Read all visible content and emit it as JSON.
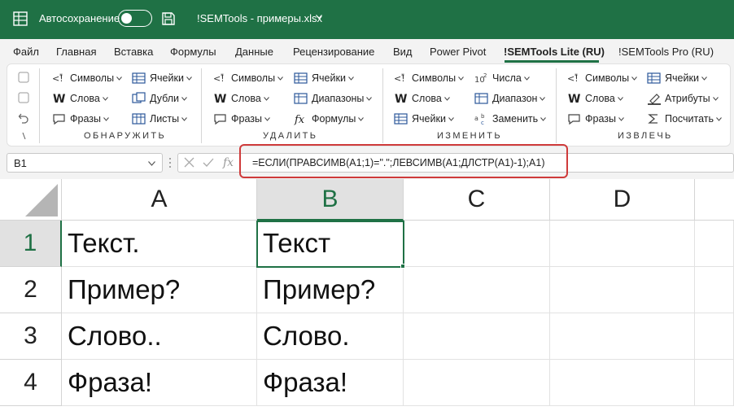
{
  "titlebar": {
    "autosave_label": "Автосохранение",
    "filename": "!SEMTools - примеры.xlsx",
    "bg_color": "#1f7145"
  },
  "tabs": [
    {
      "label": "Файл"
    },
    {
      "label": "Главная"
    },
    {
      "label": "Вставка"
    },
    {
      "label": "Формулы"
    },
    {
      "label": "Данные"
    },
    {
      "label": "Рецензирование"
    },
    {
      "label": "Вид"
    },
    {
      "label": "Power Pivot"
    },
    {
      "label": "!SEMTools Lite (RU)",
      "active": true
    },
    {
      "label": "!SEMTools Pro (RU)"
    }
  ],
  "ribbon": {
    "groups": [
      {
        "label": "ОБНАРУЖИТЬ",
        "buttons": [
          "Символы",
          "Ячейки",
          "Слова",
          "Дубли",
          "Фразы",
          "Листы"
        ]
      },
      {
        "label": "УДАЛИТЬ",
        "buttons": [
          "Символы",
          "Ячейки",
          "Слова",
          "Диапазоны",
          "Фразы",
          "Формулы"
        ]
      },
      {
        "label": "ИЗМЕНИТЬ",
        "buttons": [
          "Символы",
          "Числа",
          "Слова",
          "Диапазон",
          "Ячейки",
          "Заменить"
        ]
      },
      {
        "label": "ИЗВЛЕЧЬ",
        "buttons": [
          "Символы",
          "Ячейки",
          "Слова",
          "Атрибуты",
          "Фразы",
          "Посчитать"
        ]
      }
    ]
  },
  "formula_bar": {
    "name_box": "B1",
    "fx_label": "fx",
    "formula": "=ЕСЛИ(ПРАВСИМВ(A1;1)=\".\";ЛЕВСИМВ(A1;ДЛСТР(A1)-1);A1)",
    "highlight_color": "#cf3b3b"
  },
  "sheet": {
    "columns": [
      "A",
      "B",
      "C",
      "D"
    ],
    "selected_column": "B",
    "rows": [
      {
        "num": "1",
        "cells": [
          "Текст.",
          "Текст",
          "",
          ""
        ]
      },
      {
        "num": "2",
        "cells": [
          "Пример?",
          "Пример?",
          "",
          ""
        ]
      },
      {
        "num": "3",
        "cells": [
          "Слово..",
          "Слово.",
          "",
          ""
        ]
      },
      {
        "num": "4",
        "cells": [
          "Фраза!",
          "Фраза!",
          "",
          ""
        ]
      }
    ],
    "selected_row": "1",
    "active_cell": "B1",
    "accent_color": "#1f7145"
  }
}
